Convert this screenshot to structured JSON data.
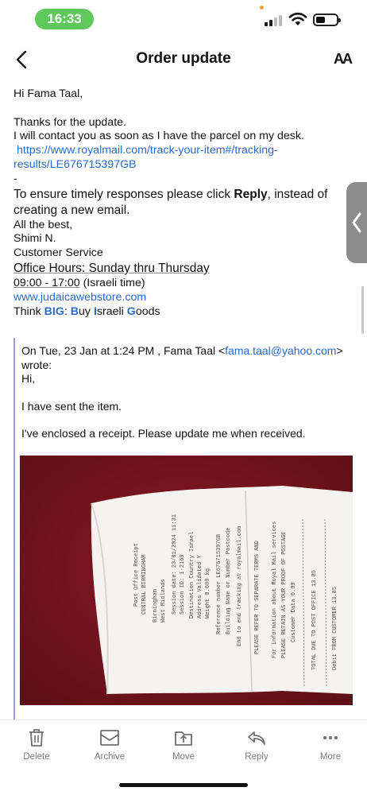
{
  "status_bar": {
    "time": "16:33"
  },
  "header": {
    "title": "Order update",
    "text_size_label": "AA"
  },
  "email": {
    "greeting": "Hi Fama Taal,",
    "line1": "Thanks for the update.",
    "line2": "I will contact you as soon as I have the parcel on my desk.",
    "tracking_link_1": "https://www.royalmail.com/track-your-item#/tracking-",
    "tracking_link_2": "results/LE676715397GB",
    "dash": "-",
    "reply_pre": "To ensure timely responses please click ",
    "reply_bold": "Reply",
    "reply_post": ", instead of",
    "reply_line2": "creating a new email.",
    "signoff": "All the best,",
    "name": "Shimi N.",
    "dept": "Customer Service",
    "hours_line1": "Office Hours: Sunday thru Thursday",
    "hours_line2": "09:00 - 17:00",
    "hours_tz": " (Israeli time)",
    "website": "www.judaicawebstore.com",
    "motto_pre": "Think ",
    "motto_big": "BIG",
    "motto_colon": ": ",
    "motto_b": "B",
    "motto_uy": "uy ",
    "motto_i": "I",
    "motto_sraeli": "sraeli ",
    "motto_g": "G",
    "motto_oods": "oods"
  },
  "quote": {
    "header_1": "On Tue, 23 Jan at 1:24 PM , Fama Taal <",
    "header_email": "fama.taal@yahoo.com",
    "header_2": ">",
    "header_3": "wrote:",
    "hi": "Hi,",
    "sent": "I have sent the item.",
    "enclosed": "I've enclosed a receipt. Please update me when received."
  },
  "toolbar": {
    "delete": "Delete",
    "archive": "Archive",
    "move": "Move",
    "reply": "Reply",
    "more": "More"
  },
  "colors": {
    "link": "#2a68c9",
    "quote_bar": "#9a9ae8",
    "time_pill": "#5ec85a",
    "photo_background": "#7d1620"
  }
}
